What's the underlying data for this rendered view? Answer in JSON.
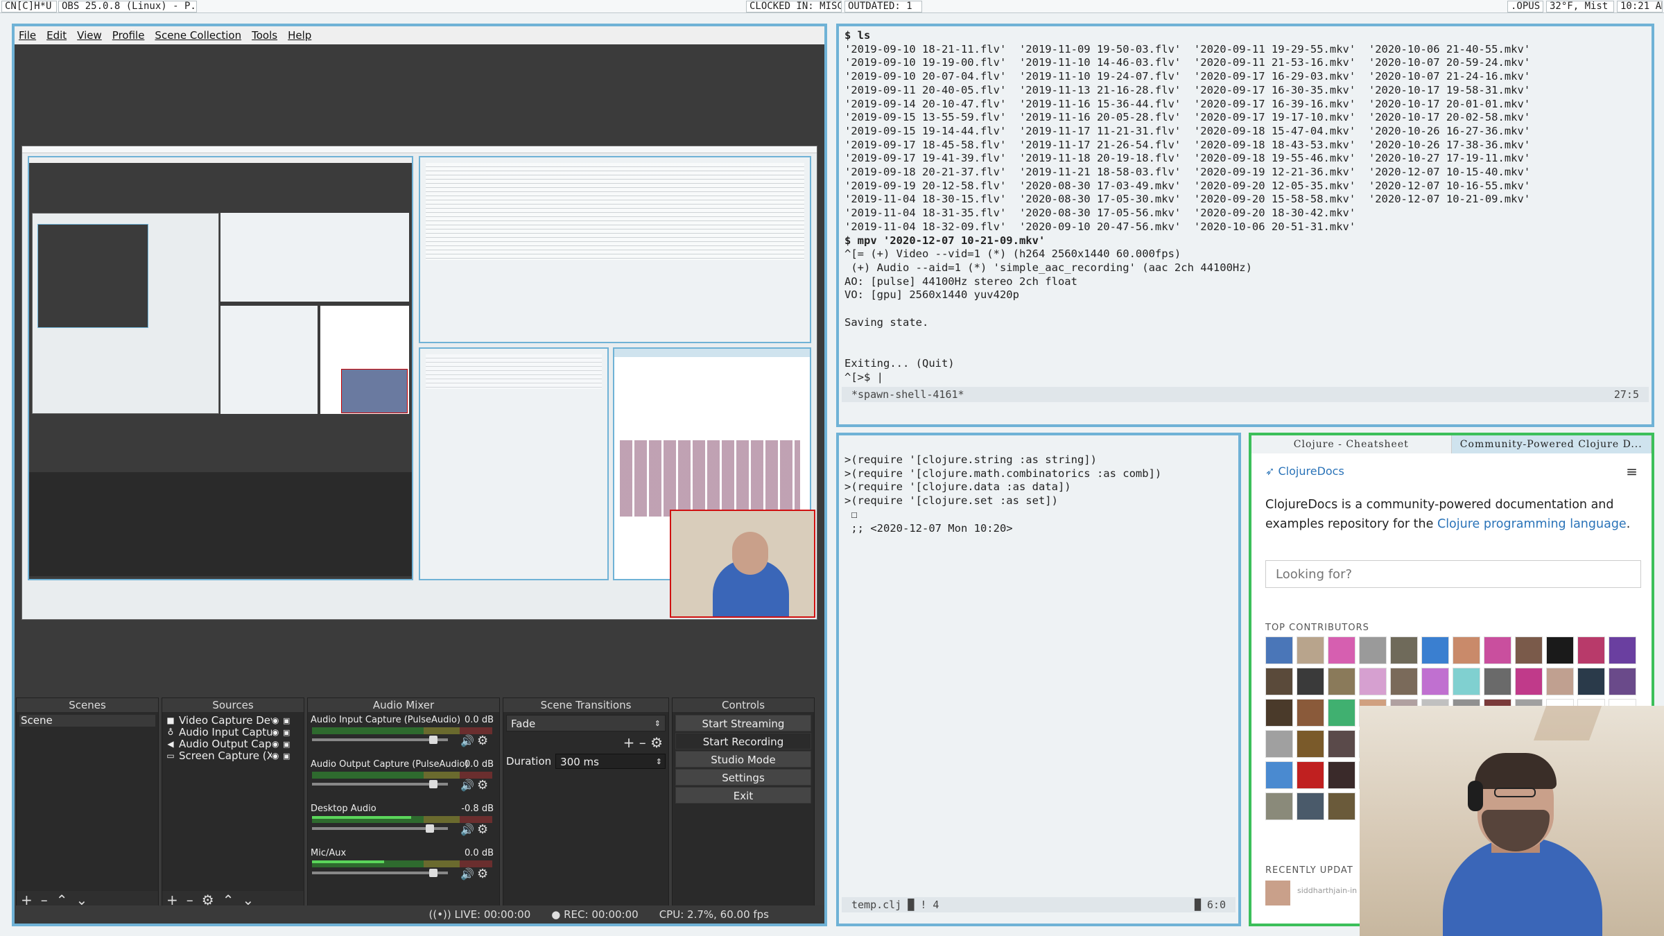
{
  "topbar": {
    "tag": "CN[C]H*U",
    "window_title": "OBS 25.0.8 (Linux) - P...",
    "clock_status": "CLOCKED IN: MISC",
    "outdated": "OUTDATED: 1",
    "opus": ".OPUS",
    "weather": "32°F, Mist",
    "time": "10:21 AM"
  },
  "obs": {
    "menu": [
      "File",
      "Edit",
      "View",
      "Profile",
      "Scene Collection",
      "Tools",
      "Help"
    ],
    "scenes": {
      "title": "Scenes",
      "items": [
        "Scene"
      ]
    },
    "sources": {
      "title": "Sources",
      "items": [
        {
          "name": "Video Capture Dev",
          "icon": "camera-icon"
        },
        {
          "name": "Audio Input Captur",
          "icon": "microphone-icon"
        },
        {
          "name": "Audio Output Capt",
          "icon": "speaker-icon"
        },
        {
          "name": "Screen Capture (X!",
          "icon": "monitor-icon"
        }
      ]
    },
    "mixer": {
      "title": "Audio Mixer",
      "channels": [
        {
          "name": "Audio Input Capture (PulseAudio)",
          "db": "0.0 dB",
          "level": 0.0,
          "slider": 0.92
        },
        {
          "name": "Audio Output Capture (PulseAudio)",
          "db": "0.0 dB",
          "level": 0.0,
          "slider": 0.92
        },
        {
          "name": "Desktop Audio",
          "db": "-0.8 dB",
          "level": 0.55,
          "slider": 0.89
        },
        {
          "name": "Mic/Aux",
          "db": "0.0 dB",
          "level": 0.4,
          "slider": 0.92
        }
      ]
    },
    "transitions": {
      "title": "Scene Transitions",
      "selected": "Fade",
      "duration_label": "Duration",
      "duration_value": "300 ms"
    },
    "controls": {
      "title": "Controls",
      "buttons": [
        "Start Streaming",
        "Start Recording",
        "Studio Mode",
        "Settings",
        "Exit"
      ]
    },
    "status": {
      "live": "LIVE: 00:00:00",
      "rec": "REC: 00:00:00",
      "cpu": "CPU: 2.7%, 60.00 fps"
    }
  },
  "terminal": {
    "lines": [
      "$ ls",
      "'2019-09-10 18-21-11.flv'  '2019-11-09 19-50-03.flv'  '2020-09-11 19-29-55.mkv'  '2020-10-06 21-40-55.mkv'",
      "'2019-09-10 19-19-00.flv'  '2019-11-10 14-46-03.flv'  '2020-09-11 21-53-16.mkv'  '2020-10-07 20-59-24.mkv'",
      "'2019-09-10 20-07-04.flv'  '2019-11-10 19-24-07.flv'  '2020-09-17 16-29-03.mkv'  '2020-10-07 21-24-16.mkv'",
      "'2019-09-11 20-40-05.flv'  '2019-11-13 21-16-28.flv'  '2020-09-17 16-30-35.mkv'  '2020-10-17 19-58-31.mkv'",
      "'2019-09-14 20-10-47.flv'  '2019-11-16 15-36-44.flv'  '2020-09-17 16-39-16.mkv'  '2020-10-17 20-01-01.mkv'",
      "'2019-09-15 13-55-59.flv'  '2019-11-16 20-05-28.flv'  '2020-09-17 19-17-10.mkv'  '2020-10-17 20-02-58.mkv'",
      "'2019-09-15 19-14-44.flv'  '2019-11-17 11-21-31.flv'  '2020-09-18 15-47-04.mkv'  '2020-10-26 16-27-36.mkv'",
      "'2019-09-17 18-45-58.flv'  '2019-11-17 21-26-54.flv'  '2020-09-18 18-43-53.mkv'  '2020-10-26 17-38-36.mkv'",
      "'2019-09-17 19-41-39.flv'  '2019-11-18 20-19-18.flv'  '2020-09-18 19-55-46.mkv'  '2020-10-27 17-19-11.mkv'",
      "'2019-09-18 20-21-37.flv'  '2019-11-21 18-58-03.flv'  '2020-09-19 12-21-36.mkv'  '2020-12-07 10-15-40.mkv'",
      "'2019-09-19 20-12-58.flv'  '2020-08-30 17-03-49.mkv'  '2020-09-20 12-05-35.mkv'  '2020-12-07 10-16-55.mkv'",
      "'2019-11-04 18-30-15.flv'  '2020-08-30 17-05-30.mkv'  '2020-09-20 15-58-58.mkv'  '2020-12-07 10-21-09.mkv'",
      "'2019-11-04 18-31-35.flv'  '2020-08-30 17-05-56.mkv'  '2020-09-20 18-30-42.mkv'",
      "'2019-11-04 18-32-09.flv'  '2020-09-10 20-47-56.mkv'  '2020-10-06 20-51-31.mkv'",
      "$ mpv '2020-12-07 10-21-09.mkv'",
      "^[= (+) Video --vid=1 (*) (h264 2560x1440 60.000fps)",
      " (+) Audio --aid=1 (*) 'simple_aac_recording' (aac 2ch 44100Hz)",
      "AO: [pulse] 44100Hz stereo 2ch float",
      "VO: [gpu] 2560x1440 yuv420p",
      "",
      "Saving state.",
      "",
      "",
      "Exiting... (Quit)",
      "^[>$ |"
    ],
    "modeline_left": "*spawn-shell-4161*",
    "modeline_right": "27:5"
  },
  "repl": {
    "lines": [
      ">(require '[clojure.string :as string])",
      ">(require '[clojure.math.combinatorics :as comb])",
      ">(require '[clojure.data :as data])",
      ">(require '[clojure.set :as set])",
      " ☐",
      " ;; <2020-12-07 Mon 10:20>"
    ],
    "modeline_left": "temp.clj  █ ! 4",
    "modeline_right": "█ 6:0"
  },
  "browser": {
    "tabs": [
      "Clojure - Cheatsheet",
      "Community-Powered Clojure D..."
    ],
    "logo_text": "ClojureDocs",
    "intro": "ClojureDocs is a community-powered documentation and examples repository for the ",
    "intro_link": "Clojure programming language",
    "intro_end": ".",
    "search_placeholder": "Looking for?",
    "contributors_heading": "TOP CONTRIBUTORS",
    "recent_heading": "RECENTLY UPDAT",
    "recent_user": "siddharthjain-in",
    "avatar_colors": [
      "#4a76b8",
      "#b8a48c",
      "#d65fb0",
      "#9a9a9a",
      "#6f6a5a",
      "#3a7fd0",
      "#c98a6a",
      "#c94f9e",
      "#7a5a4a",
      "#1a1a1a",
      "#b83a6a",
      "#6a3fa0",
      "#5a4a3a",
      "#3a3a3a",
      "#8a7a5a",
      "#d6a0d0",
      "#7a6a5a",
      "#c070d0",
      "#80d0d0",
      "#6a6a6a",
      "#c03a8a",
      "#c0a090",
      "#2a3a4a",
      "#6a4a8a",
      "#4a3a2a",
      "#8a5a3a",
      "#40b070",
      "#d0a080",
      "#b0a0a0",
      "#c0c0c0",
      "#909090",
      "#7a3a3a",
      "#a0a0a0",
      "#ffffff",
      "#ffffff",
      "#ffffff",
      "#a0a0a0",
      "#7a5a2a",
      "#5a4a4a",
      "#dddddd",
      "#ffffff",
      "#ffffff",
      "#ffffff",
      "#ffffff",
      "#ffffff",
      "#ffffff",
      "#ffffff",
      "#ffffff",
      "#4a8ad0",
      "#c02020",
      "#3a2a2a",
      "#ffffff",
      "#ffffff",
      "#ffffff",
      "#ffffff",
      "#ffffff",
      "#ffffff",
      "#ffffff",
      "#ffffff",
      "#ffffff",
      "#8a8a7a",
      "#4a5a6a",
      "#6a5a3a"
    ]
  },
  "colors": {
    "frame_accent": "#6fb2d6",
    "obs_bg": "#3b3b3b",
    "term_bg": "#eef2f4",
    "webcam_shirt": "#3a66b8",
    "link": "#2a73b8"
  }
}
